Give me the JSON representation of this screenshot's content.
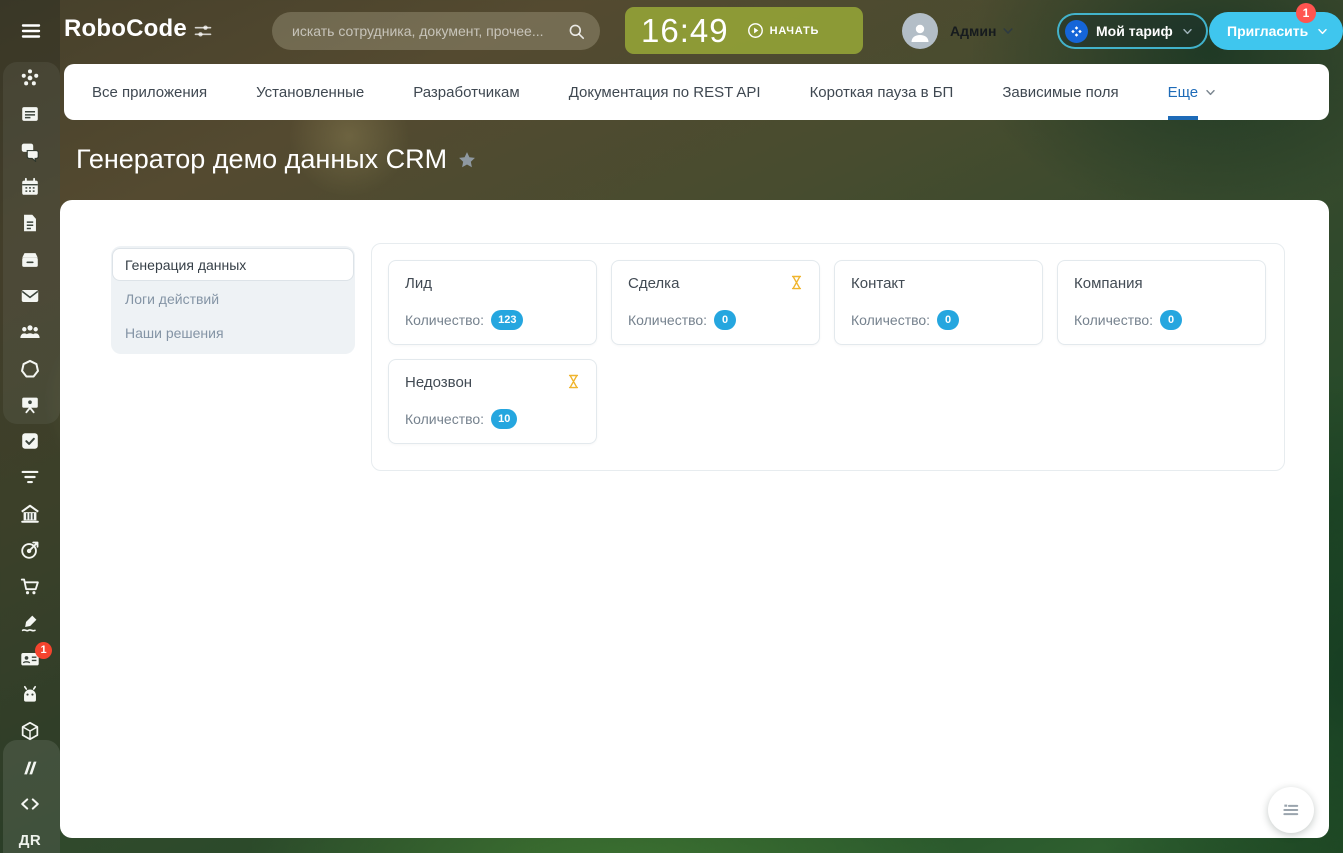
{
  "header": {
    "logo": "RoboCode",
    "search_placeholder": "искать сотрудника, документ, прочее...",
    "time": "16:49",
    "start_label": "НАЧАТЬ",
    "user_name": "Админ",
    "tariff_label": "Мой тариф",
    "invite_label": "Пригласить",
    "invite_badge": "1"
  },
  "tabs": [
    {
      "name": "tab-all-apps",
      "label": "Все приложения"
    },
    {
      "name": "tab-installed",
      "label": "Установленные"
    },
    {
      "name": "tab-developers",
      "label": "Разработчикам"
    },
    {
      "name": "tab-rest-api-docs",
      "label": "Документация по REST API"
    },
    {
      "name": "tab-short-pause-bp",
      "label": "Короткая пауза в БП"
    },
    {
      "name": "tab-dependent-fields",
      "label": "Зависимые поля"
    },
    {
      "name": "tab-more",
      "label": "Еще",
      "active": true,
      "chevron": true
    }
  ],
  "page": {
    "title": "Генератор демо данных CRM"
  },
  "inner_menu": [
    {
      "name": "menu-item-data-generation",
      "label": "Генерация данных",
      "active": true
    },
    {
      "name": "menu-item-action-logs",
      "label": "Логи действий"
    },
    {
      "name": "menu-item-our-solutions",
      "label": "Наши решения"
    }
  ],
  "cards": [
    {
      "name": "card-lead",
      "title": "Лид",
      "count_label": "Количество:",
      "count": "123"
    },
    {
      "name": "card-deal",
      "title": "Сделка",
      "count_label": "Количество:",
      "count": "0",
      "hourglass": true
    },
    {
      "name": "card-contact",
      "title": "Контакт",
      "count_label": "Количество:",
      "count": "0"
    },
    {
      "name": "card-company",
      "title": "Компания",
      "count_label": "Количество:",
      "count": "0"
    },
    {
      "name": "card-missed-call",
      "title": "Недозвон",
      "count_label": "Количество:",
      "count": "10",
      "hourglass": true
    }
  ],
  "sidebar_icons": [
    {
      "name": "pulse-icon",
      "icon": "pulse"
    },
    {
      "name": "live-feed-icon",
      "icon": "feed"
    },
    {
      "name": "messenger-icon",
      "icon": "chat"
    },
    {
      "name": "calendar-icon",
      "icon": "calendar"
    },
    {
      "name": "documents-icon",
      "icon": "docs"
    },
    {
      "name": "drive-icon",
      "icon": "drive"
    },
    {
      "name": "mail-icon",
      "icon": "mail"
    },
    {
      "name": "workgroups-icon",
      "icon": "people"
    },
    {
      "name": "crm-icon",
      "icon": "crm"
    },
    {
      "name": "marketing-icon",
      "icon": "marketing"
    },
    {
      "name": "tasks-icon",
      "icon": "tasks"
    },
    {
      "name": "sales-funnel-icon",
      "icon": "funnel"
    },
    {
      "name": "company-icon",
      "icon": "building"
    },
    {
      "name": "goals-icon",
      "icon": "target"
    },
    {
      "name": "shop-icon",
      "icon": "cart"
    },
    {
      "name": "sign-icon",
      "icon": "sign"
    },
    {
      "name": "contact-center-icon",
      "icon": "card",
      "badge": "1"
    },
    {
      "name": "robot-icon",
      "icon": "robot"
    },
    {
      "name": "cube-app-icon",
      "icon": "cube"
    },
    {
      "name": "make-icon",
      "icon": "make"
    },
    {
      "name": "developer-icon",
      "icon": "dev"
    },
    {
      "name": "app-initials",
      "label": "ДR"
    }
  ],
  "colors": {
    "accent_blue": "#1e6bb8",
    "invite_cyan": "#3fc6ee",
    "badge_red": "#ff5450",
    "count_blue": "#25a6df",
    "timeman_olive": "#94a337",
    "hourglass_amber": "#f0b52e",
    "tariff_circle_blue": "#1565d8"
  }
}
